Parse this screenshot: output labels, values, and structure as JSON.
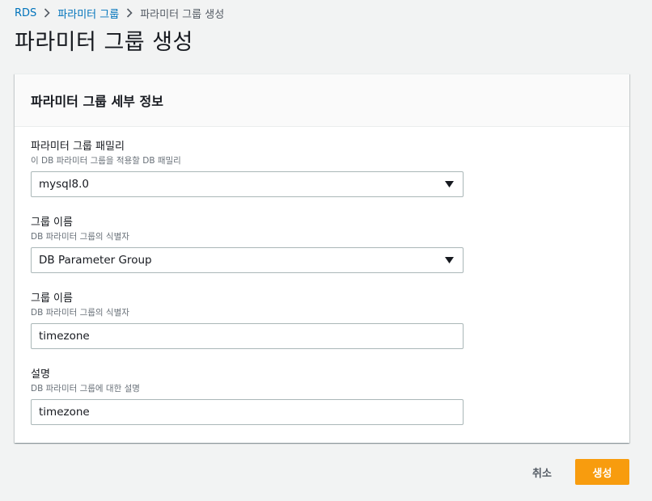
{
  "breadcrumb": {
    "items": [
      "RDS",
      "파라미터 그룹",
      "파라미터 그룹 생성"
    ]
  },
  "page_title": "파라미터 그룹 생성",
  "panel": {
    "title": "파라미터 그룹 세부 정보",
    "fields": [
      {
        "label": "파라미터 그룹 패밀리",
        "description": "이 DB 파라미터 그룹을 적용할 DB 패밀리",
        "value": "mysql8.0",
        "type": "select"
      },
      {
        "label": "그룹 이름",
        "description": "DB 파라미터 그룹의 식별자",
        "value": "DB Parameter Group",
        "type": "select"
      },
      {
        "label": "그룹 이름",
        "description": "DB 파라미터 그룹의 식별자",
        "value": "timezone",
        "type": "text"
      },
      {
        "label": "설명",
        "description": "DB 파라미터 그룹에 대한 설명",
        "value": "timezone",
        "type": "text"
      }
    ]
  },
  "actions": {
    "cancel_label": "취소",
    "create_label": "생성"
  },
  "colors": {
    "link": "#0073bb",
    "primary_button": "#f89c0e",
    "background": "#f2f3f3"
  },
  "icons": {
    "breadcrumb_separator": "chevron-right-icon",
    "select_caret": "caret-down-icon"
  }
}
